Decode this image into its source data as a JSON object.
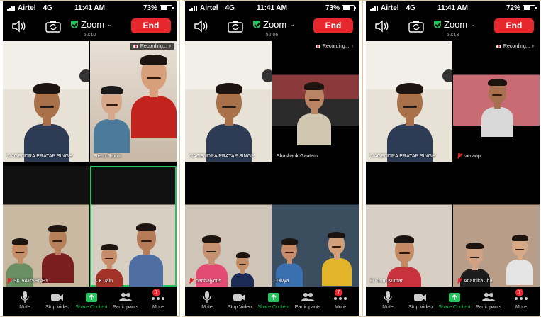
{
  "phones": [
    {
      "status": {
        "carrier": "Airtel",
        "network": "4G",
        "time": "11:41 AM",
        "battery": "73%",
        "battery_level": 0.73
      },
      "toolbar": {
        "title": "Zoom",
        "subtitle": "52:10",
        "end_label": "End"
      },
      "recording_label": "Recording...",
      "tiles": [
        {
          "name": "NAGENDRA PRATAP SINGH",
          "muted": false,
          "active": false
        },
        {
          "name": "Renu Raina",
          "muted": false,
          "active": false
        },
        {
          "name": "SK VARSHNEY",
          "muted": true,
          "active": false
        },
        {
          "name": "K.K.Jain",
          "muted": false,
          "active": true
        }
      ],
      "bottom": {
        "mute": "Mute",
        "video": "Stop Video",
        "share": "Share Content",
        "participants": "Participants",
        "more": "More",
        "badge": "7"
      }
    },
    {
      "status": {
        "carrier": "Airtel",
        "network": "4G",
        "time": "11:41 AM",
        "battery": "73%",
        "battery_level": 0.73
      },
      "toolbar": {
        "title": "Zoom",
        "subtitle": "52:06",
        "end_label": "End"
      },
      "recording_label": "Recording...",
      "tiles": [
        {
          "name": "NAGENDRA PRATAP SINGH",
          "muted": false,
          "active": false
        },
        {
          "name": "Shashank Gautam",
          "muted": false,
          "active": false
        },
        {
          "name": "parthajyotis",
          "muted": true,
          "active": false
        },
        {
          "name": "Divya",
          "muted": false,
          "active": false
        }
      ],
      "bottom": {
        "mute": "Mute",
        "video": "Stop Video",
        "share": "Share Content",
        "participants": "Participants",
        "more": "More",
        "badge": "7"
      }
    },
    {
      "status": {
        "carrier": "Airtel",
        "network": "4G",
        "time": "11:41 AM",
        "battery": "72%",
        "battery_level": 0.72
      },
      "toolbar": {
        "title": "Zoom",
        "subtitle": "52:13",
        "end_label": "End"
      },
      "recording_label": "Recording...",
      "tiles": [
        {
          "name": "NAGENDRA PRATAP SINGH",
          "muted": false,
          "active": false
        },
        {
          "name": "ramanp",
          "muted": true,
          "active": false
        },
        {
          "name": "D Kiran Kumar",
          "muted": false,
          "active": false
        },
        {
          "name": "Anamika Jha",
          "muted": true,
          "active": false
        }
      ],
      "bottom": {
        "mute": "Mute",
        "video": "Stop Video",
        "share": "Share Content",
        "participants": "Participants",
        "more": "More",
        "badge": "7"
      }
    }
  ],
  "colors": {
    "end": "#e5282e",
    "active_border": "#22c55e",
    "share": "#22c55e",
    "background": "#000000"
  },
  "icons": {
    "speaker": "speaker-icon",
    "camera_flip": "camera-flip-icon",
    "shield": "shield-check-icon",
    "mic": "microphone-icon",
    "video": "video-camera-icon",
    "share": "share-arrow-icon",
    "participants": "participants-icon",
    "more": "more-dots-icon",
    "recording": "cloud-record-icon"
  }
}
